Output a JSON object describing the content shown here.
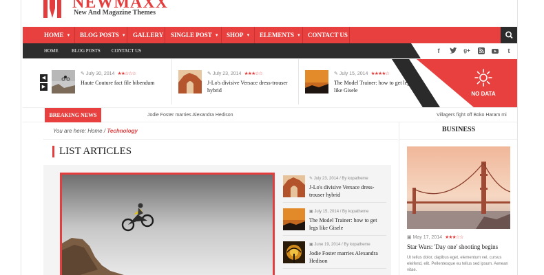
{
  "header": {
    "logo_title": "NEWMAXX",
    "logo_subtitle": "New And Magazine Themes",
    "brand_color": "#e8403e"
  },
  "main_nav": {
    "items": [
      {
        "label": "HOME",
        "has_dropdown": true
      },
      {
        "label": "BLOG POSTS",
        "has_dropdown": true
      },
      {
        "label": "GALLERY",
        "has_dropdown": false
      },
      {
        "label": "SINGLE POST",
        "has_dropdown": true
      },
      {
        "label": "SHOP",
        "has_dropdown": true
      },
      {
        "label": "ELEMENTS",
        "has_dropdown": true
      },
      {
        "label": "CONTACT US",
        "has_dropdown": false
      }
    ],
    "search_icon": "search-icon"
  },
  "sub_nav": {
    "items": [
      "HOME",
      "BLOG POSTS",
      "CONTACT US"
    ],
    "social_icons": [
      "facebook-icon",
      "twitter-icon",
      "google-plus-icon",
      "rss-icon",
      "youtube-icon",
      "tumblr-icon"
    ]
  },
  "featured": {
    "posts": [
      {
        "date": "July 30, 2014",
        "title": "Haute Couture fact file bibendum",
        "rating": 2.5
      },
      {
        "date": "July 23, 2014",
        "title": "J-Lo's divisive Versace dress-trouser hybrid",
        "rating": 3
      },
      {
        "date": "July 15, 2014",
        "title": "The Model Trainer: how to get legs like Gisele",
        "rating": 4
      }
    ],
    "weather": {
      "text": "NO DATA",
      "icon": "sun-icon"
    }
  },
  "breaking": {
    "label": "BREAKING NEWS",
    "items": [
      "Jodie Foster marries Alexandra Hedison",
      "Villagers fight off Boko Haram mi"
    ]
  },
  "breadcrumb": {
    "prefix": "You are here:",
    "home": "Home",
    "separator": "/",
    "current": "Technology"
  },
  "list_articles": {
    "title": "LIST ARTICLES",
    "side_posts": [
      {
        "date": "July 23, 2014",
        "author": "kopatheme",
        "title": "J-Lo's divisive Versace dress-trouser hybrid"
      },
      {
        "date": "July 15, 2014",
        "author": "kopatheme",
        "title": "The Model Trainer: how to get legs like Gisele"
      },
      {
        "date": "June 19, 2014",
        "author": "kopatheme",
        "title": "Jodie Foster marries Alexandra Hedison"
      }
    ]
  },
  "sidebar": {
    "title": "BUSINESS",
    "post": {
      "date": "May 17, 2014",
      "rating": 3,
      "title": "Star Wars: 'Day one' shooting begins",
      "excerpt": "Ut tellus dolor, dapibus eget, elementum vel, cursus eleifend, elit. Pellentesque eu tellus sed ipsum. Aenean vitae."
    }
  }
}
